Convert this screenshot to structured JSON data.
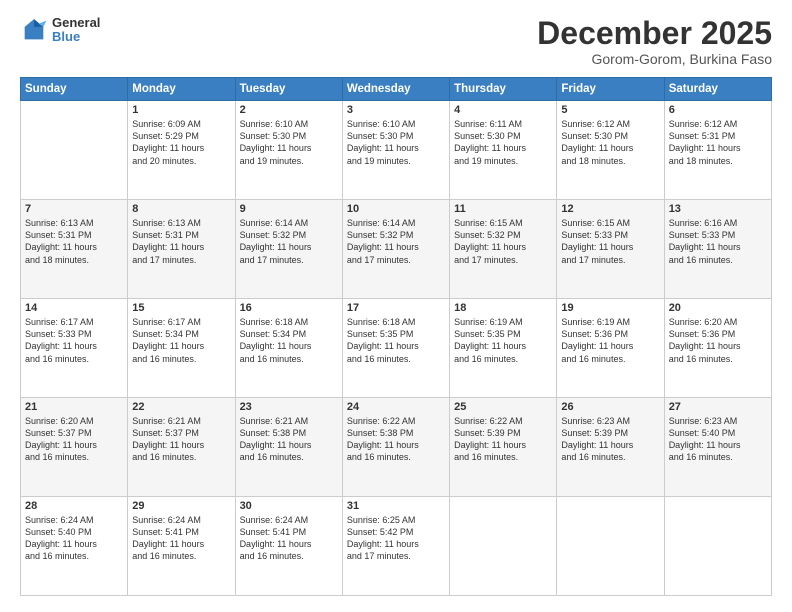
{
  "logo": {
    "general": "General",
    "blue": "Blue"
  },
  "header": {
    "month": "December 2025",
    "location": "Gorom-Gorom, Burkina Faso"
  },
  "days_of_week": [
    "Sunday",
    "Monday",
    "Tuesday",
    "Wednesday",
    "Thursday",
    "Friday",
    "Saturday"
  ],
  "weeks": [
    [
      {
        "day": "",
        "info": ""
      },
      {
        "day": "1",
        "info": "Sunrise: 6:09 AM\nSunset: 5:29 PM\nDaylight: 11 hours\nand 20 minutes."
      },
      {
        "day": "2",
        "info": "Sunrise: 6:10 AM\nSunset: 5:30 PM\nDaylight: 11 hours\nand 19 minutes."
      },
      {
        "day": "3",
        "info": "Sunrise: 6:10 AM\nSunset: 5:30 PM\nDaylight: 11 hours\nand 19 minutes."
      },
      {
        "day": "4",
        "info": "Sunrise: 6:11 AM\nSunset: 5:30 PM\nDaylight: 11 hours\nand 19 minutes."
      },
      {
        "day": "5",
        "info": "Sunrise: 6:12 AM\nSunset: 5:30 PM\nDaylight: 11 hours\nand 18 minutes."
      },
      {
        "day": "6",
        "info": "Sunrise: 6:12 AM\nSunset: 5:31 PM\nDaylight: 11 hours\nand 18 minutes."
      }
    ],
    [
      {
        "day": "7",
        "info": "Sunrise: 6:13 AM\nSunset: 5:31 PM\nDaylight: 11 hours\nand 18 minutes."
      },
      {
        "day": "8",
        "info": "Sunrise: 6:13 AM\nSunset: 5:31 PM\nDaylight: 11 hours\nand 17 minutes."
      },
      {
        "day": "9",
        "info": "Sunrise: 6:14 AM\nSunset: 5:32 PM\nDaylight: 11 hours\nand 17 minutes."
      },
      {
        "day": "10",
        "info": "Sunrise: 6:14 AM\nSunset: 5:32 PM\nDaylight: 11 hours\nand 17 minutes."
      },
      {
        "day": "11",
        "info": "Sunrise: 6:15 AM\nSunset: 5:32 PM\nDaylight: 11 hours\nand 17 minutes."
      },
      {
        "day": "12",
        "info": "Sunrise: 6:15 AM\nSunset: 5:33 PM\nDaylight: 11 hours\nand 17 minutes."
      },
      {
        "day": "13",
        "info": "Sunrise: 6:16 AM\nSunset: 5:33 PM\nDaylight: 11 hours\nand 16 minutes."
      }
    ],
    [
      {
        "day": "14",
        "info": "Sunrise: 6:17 AM\nSunset: 5:33 PM\nDaylight: 11 hours\nand 16 minutes."
      },
      {
        "day": "15",
        "info": "Sunrise: 6:17 AM\nSunset: 5:34 PM\nDaylight: 11 hours\nand 16 minutes."
      },
      {
        "day": "16",
        "info": "Sunrise: 6:18 AM\nSunset: 5:34 PM\nDaylight: 11 hours\nand 16 minutes."
      },
      {
        "day": "17",
        "info": "Sunrise: 6:18 AM\nSunset: 5:35 PM\nDaylight: 11 hours\nand 16 minutes."
      },
      {
        "day": "18",
        "info": "Sunrise: 6:19 AM\nSunset: 5:35 PM\nDaylight: 11 hours\nand 16 minutes."
      },
      {
        "day": "19",
        "info": "Sunrise: 6:19 AM\nSunset: 5:36 PM\nDaylight: 11 hours\nand 16 minutes."
      },
      {
        "day": "20",
        "info": "Sunrise: 6:20 AM\nSunset: 5:36 PM\nDaylight: 11 hours\nand 16 minutes."
      }
    ],
    [
      {
        "day": "21",
        "info": "Sunrise: 6:20 AM\nSunset: 5:37 PM\nDaylight: 11 hours\nand 16 minutes."
      },
      {
        "day": "22",
        "info": "Sunrise: 6:21 AM\nSunset: 5:37 PM\nDaylight: 11 hours\nand 16 minutes."
      },
      {
        "day": "23",
        "info": "Sunrise: 6:21 AM\nSunset: 5:38 PM\nDaylight: 11 hours\nand 16 minutes."
      },
      {
        "day": "24",
        "info": "Sunrise: 6:22 AM\nSunset: 5:38 PM\nDaylight: 11 hours\nand 16 minutes."
      },
      {
        "day": "25",
        "info": "Sunrise: 6:22 AM\nSunset: 5:39 PM\nDaylight: 11 hours\nand 16 minutes."
      },
      {
        "day": "26",
        "info": "Sunrise: 6:23 AM\nSunset: 5:39 PM\nDaylight: 11 hours\nand 16 minutes."
      },
      {
        "day": "27",
        "info": "Sunrise: 6:23 AM\nSunset: 5:40 PM\nDaylight: 11 hours\nand 16 minutes."
      }
    ],
    [
      {
        "day": "28",
        "info": "Sunrise: 6:24 AM\nSunset: 5:40 PM\nDaylight: 11 hours\nand 16 minutes."
      },
      {
        "day": "29",
        "info": "Sunrise: 6:24 AM\nSunset: 5:41 PM\nDaylight: 11 hours\nand 16 minutes."
      },
      {
        "day": "30",
        "info": "Sunrise: 6:24 AM\nSunset: 5:41 PM\nDaylight: 11 hours\nand 16 minutes."
      },
      {
        "day": "31",
        "info": "Sunrise: 6:25 AM\nSunset: 5:42 PM\nDaylight: 11 hours\nand 17 minutes."
      },
      {
        "day": "",
        "info": ""
      },
      {
        "day": "",
        "info": ""
      },
      {
        "day": "",
        "info": ""
      }
    ]
  ]
}
